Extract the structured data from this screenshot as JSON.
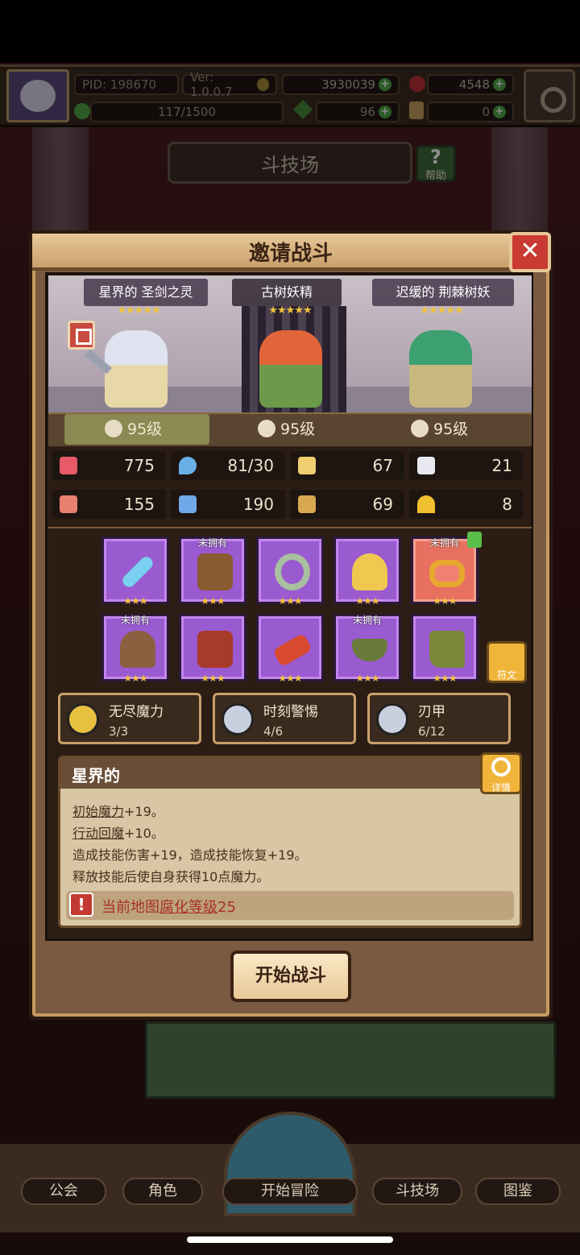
{
  "top": {
    "pid": "PID: 198670",
    "version": "Ver: 1.0.0.7",
    "gold": "3930039",
    "gems": "4548",
    "energy": "117/1500",
    "clover": "96",
    "key_count": "0"
  },
  "arena": {
    "title": "斗技场",
    "help_label": "帮助"
  },
  "dialog": {
    "title": "邀请战斗",
    "close_label": "✕"
  },
  "heroes": [
    {
      "name": "星界的 圣剑之灵",
      "stars": "★★★★★",
      "level": "95级"
    },
    {
      "name": "古树妖精",
      "stars": "★★★★★",
      "level": "95级"
    },
    {
      "name": "迟缓的 荆棘树妖",
      "stars": "★★★★★",
      "level": "95级"
    }
  ],
  "stats": [
    {
      "icon": "heart-icon",
      "value": "775",
      "color": "#e85a6a"
    },
    {
      "icon": "mana-drop-icon",
      "value": "81/30",
      "color": "#6ab0e8"
    },
    {
      "icon": "shield-icon",
      "value": "67",
      "color": "#f0d070"
    },
    {
      "icon": "wing-icon",
      "value": "21",
      "color": "#e8e8f0"
    },
    {
      "icon": "fist-icon",
      "value": "155",
      "color": "#e88070"
    },
    {
      "icon": "book-icon",
      "value": "190",
      "color": "#70a8e8"
    },
    {
      "icon": "scroll-icon",
      "value": "69",
      "color": "#d8a850"
    },
    {
      "icon": "horseshoe-icon",
      "value": "8",
      "color": "#f0c030"
    }
  ],
  "equipment": [
    {
      "name": "ice-sword-item",
      "tag": "",
      "stars": "★★★"
    },
    {
      "name": "wooden-shield-item",
      "tag": "未拥有",
      "stars": "★★★"
    },
    {
      "name": "green-amulet-item",
      "tag": "",
      "stars": "★★★"
    },
    {
      "name": "golden-crest-item",
      "tag": "",
      "stars": "★★★"
    },
    {
      "name": "golden-ring-item",
      "tag": "未拥有",
      "stars": "★★★"
    },
    {
      "name": "wooden-helmet-item",
      "tag": "未拥有",
      "stars": "★★★"
    },
    {
      "name": "red-armor-item",
      "tag": "",
      "stars": "★★★"
    },
    {
      "name": "red-glove-item",
      "tag": "",
      "stars": "★★★"
    },
    {
      "name": "green-skirt-item",
      "tag": "未拥有",
      "stars": "★★★"
    },
    {
      "name": "green-boots-item",
      "tag": "",
      "stars": "★★★"
    }
  ],
  "rune_label": "符文",
  "skills": [
    {
      "name": "无尽魔力",
      "count": "3/3"
    },
    {
      "name": "时刻警惕",
      "count": "4/6"
    },
    {
      "name": "刃甲",
      "count": "6/12"
    }
  ],
  "desc": {
    "title": "星界的",
    "detail_label": "详情",
    "line1a": "初始魔力",
    "line1b": "+19。",
    "line2a": "行动回魔",
    "line2b": "+10。",
    "line3": "造成技能伤害+19，造成技能恢复+19。",
    "line4": "释放技能后使自身获得10点魔力。",
    "warn_a": "当前地图",
    "warn_b": "腐化等级",
    "warn_c": "25"
  },
  "start_label": "开始战斗",
  "nav": {
    "guild": "公会",
    "character": "角色",
    "adventure": "开始冒险",
    "arena": "斗技场",
    "codex": "图鉴"
  }
}
